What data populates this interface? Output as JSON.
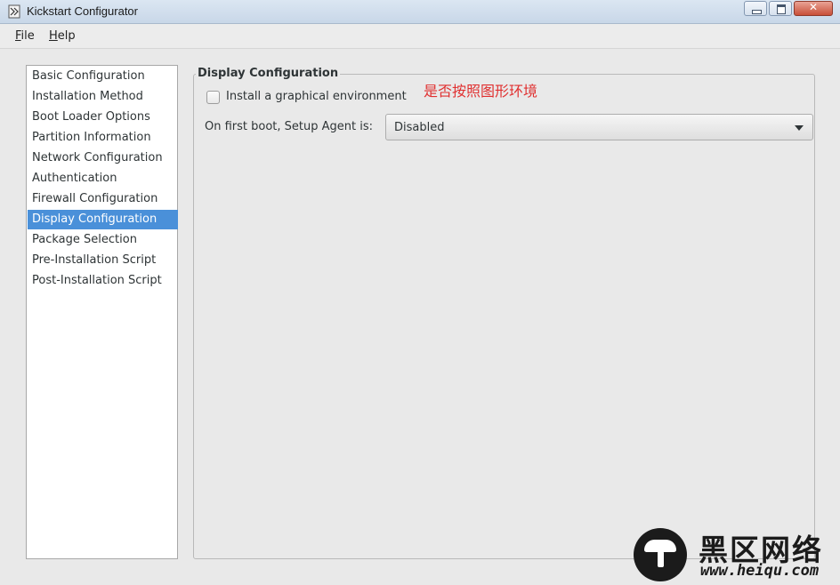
{
  "window": {
    "title": "Kickstart Configurator"
  },
  "menu": [
    {
      "mnemonic": "F",
      "rest": "ile"
    },
    {
      "mnemonic": "H",
      "rest": "elp"
    }
  ],
  "sidebar": {
    "items": [
      {
        "label": "Basic Configuration"
      },
      {
        "label": "Installation Method"
      },
      {
        "label": "Boot Loader Options"
      },
      {
        "label": "Partition Information"
      },
      {
        "label": "Network Configuration"
      },
      {
        "label": "Authentication"
      },
      {
        "label": "Firewall Configuration"
      },
      {
        "label": "Display Configuration"
      },
      {
        "label": "Package Selection"
      },
      {
        "label": "Pre-Installation Script"
      },
      {
        "label": "Post-Installation Script"
      }
    ],
    "selected": "Display Configuration"
  },
  "display": {
    "frame_title": "Display Configuration",
    "install_graphical_label": "Install a graphical environment",
    "install_graphical_checked": false,
    "annotation": "是否按照图形环境",
    "setup_agent_label": "On first boot, Setup Agent is:",
    "setup_agent_value": "Disabled"
  },
  "watermark": {
    "name": "黑区网络",
    "url": "www.heiqu.com"
  },
  "colors": {
    "selection": "#4a90d9",
    "annotation": "#e03030"
  }
}
